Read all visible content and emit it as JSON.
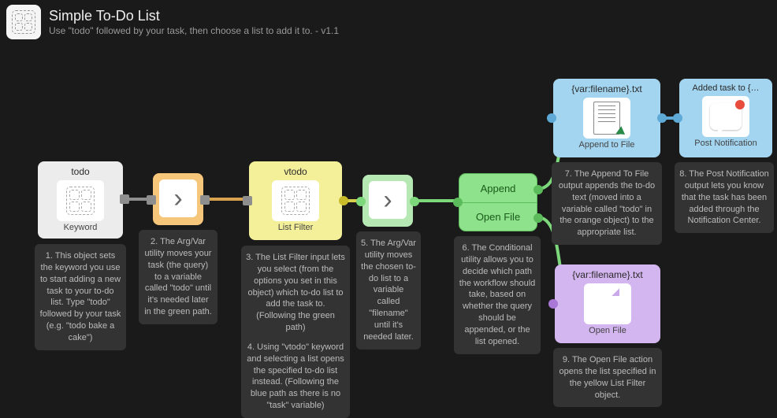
{
  "header": {
    "title": "Simple To-Do List",
    "subtitle": "Use \"todo\" followed by your task, then choose a list to add it to. - v1.1"
  },
  "nodes": {
    "n1": {
      "title": "todo",
      "caption": "Keyword"
    },
    "n2": {
      "caption": ""
    },
    "n3": {
      "title": "vtodo",
      "caption": "List Filter"
    },
    "n4": {
      "caption": ""
    },
    "n5": {
      "row1": "Append",
      "row2": "Open File"
    },
    "n6": {
      "title": "{var:filename}.txt",
      "caption": "Append to File"
    },
    "n7": {
      "title": "Added task to {…",
      "caption": "Post Notification"
    },
    "n8": {
      "title": "{var:filename}.txt",
      "caption": "Open File"
    }
  },
  "descriptions": {
    "d1": "1. This object sets the keyword you use to start adding a new task to your to-do list. Type \"todo\" followed by your task (e.g. \"todo bake a cake\")",
    "d2": "2. The Arg/Var utility moves your task (the query) to a variable called \"todo\" until it's needed later in the green path.",
    "d3a": "3. The List Filter input lets you select (from the options you set in this object) which to-do list to add the task to. (Following the green path)",
    "d3b": "4. Using \"vtodo\" keyword and selecting a list opens the specified to-do list instead. (Following the blue path as there is no \"task\" variable)",
    "d4": "5. The Arg/Var utility moves the chosen to-do list to a variable called \"filename\" until it's needed later.",
    "d5": "6. The Conditional utility allows you to decide which path the workflow should take, based on whether the query should be appended, or the list opened.",
    "d6": "7. The Append To File output appends the to-do text (moved into a variable called \"todo\" in the orange object) to the appropriate list.",
    "d7": "8. The Post Notification output lets you know that the task has been added through the Notification Center.",
    "d8": "9. The Open File action opens the list specified in the yellow List Filter object."
  }
}
